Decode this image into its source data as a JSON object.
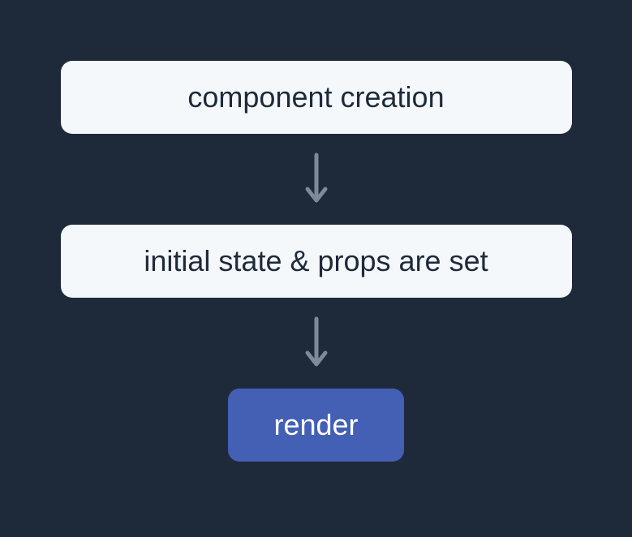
{
  "diagram": {
    "steps": [
      {
        "label": "component creation",
        "type": "light"
      },
      {
        "label": "initial state & props are set",
        "type": "light"
      },
      {
        "label": "render",
        "type": "accent"
      }
    ]
  }
}
